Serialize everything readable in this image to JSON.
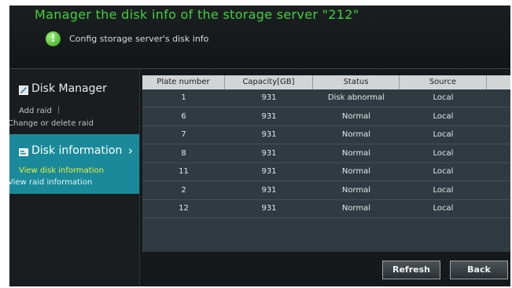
{
  "header": {
    "title": "Manager the disk info of the storage server \"212\"",
    "subtitle": "Config storage server's disk info",
    "icon": "info-icon"
  },
  "sidebar": {
    "disk_manager": {
      "title": "Disk Manager",
      "icon": "disk-manager-icon",
      "add_raid": "Add raid",
      "separator": "|",
      "change_raid": "Change or delete raid"
    },
    "disk_information": {
      "title": "Disk information",
      "icon": "disk-information-icon",
      "chevron": "›",
      "view_disk": "View disk information",
      "view_raid": "View raid information"
    }
  },
  "table": {
    "columns": [
      "Plate number",
      "Capacity[GB]",
      "Status",
      "Source"
    ],
    "rows": [
      [
        "1",
        "931",
        "Disk abnormal",
        "Local"
      ],
      [
        "6",
        "931",
        "Normal",
        "Local"
      ],
      [
        "7",
        "931",
        "Normal",
        "Local"
      ],
      [
        "8",
        "931",
        "Normal",
        "Local"
      ],
      [
        "11",
        "931",
        "Normal",
        "Local"
      ],
      [
        "2",
        "931",
        "Normal",
        "Local"
      ],
      [
        "12",
        "931",
        "Normal",
        "Local"
      ]
    ]
  },
  "buttons": {
    "refresh": "Refresh",
    "back": "Back"
  },
  "colors": {
    "title_green": "#3fd13c",
    "active_teal": "#1a8a9a",
    "active_link_yellow": "#e8ef3a"
  }
}
